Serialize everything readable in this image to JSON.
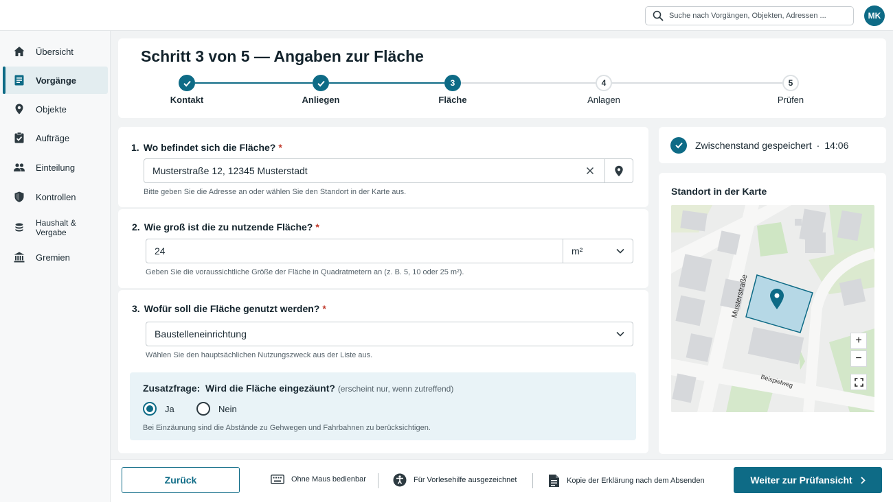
{
  "header": {
    "search_placeholder": "Suche nach Vorgängen, Objekten, Adressen ...",
    "avatar_initials": "MK"
  },
  "sidebar": {
    "items": [
      {
        "label": "Übersicht",
        "icon": "home-icon",
        "active": false
      },
      {
        "label": "Vorgänge",
        "icon": "document-list-icon",
        "active": true
      },
      {
        "label": "Objekte",
        "icon": "location-pin-icon",
        "active": false
      },
      {
        "label": "Aufträge",
        "icon": "clipboard-check-icon",
        "active": false
      },
      {
        "label": "Einteilung",
        "icon": "people-icon",
        "active": false
      },
      {
        "label": "Kontrollen",
        "icon": "shield-icon",
        "active": false
      },
      {
        "label": "Haushalt & Vergabe",
        "icon": "coins-icon",
        "active": false
      },
      {
        "label": "Gremien",
        "icon": "building-icon",
        "active": false
      }
    ]
  },
  "stepper": {
    "title": "Schritt 3 von 5 — Angaben zur Fläche",
    "steps": [
      {
        "label": "Kontakt",
        "number": "1",
        "state": "done"
      },
      {
        "label": "Anliegen",
        "number": "2",
        "state": "done"
      },
      {
        "label": "Fläche",
        "number": "3",
        "state": "current"
      },
      {
        "label": "Anlagen",
        "number": "4",
        "state": "todo"
      },
      {
        "label": "Prüfen",
        "number": "5",
        "state": "todo"
      }
    ]
  },
  "questions": {
    "q1": {
      "number": "1.",
      "label": "Wo befindet sich die Fläche?",
      "required_mark": "*",
      "value": "Musterstraße 12, 12345 Musterstadt",
      "hint": "Bitte geben Sie die Adresse an oder wählen Sie den Standort in der Karte aus."
    },
    "q2": {
      "number": "2.",
      "label": "Wie groß ist die zu nutzende Fläche?",
      "required_mark": "*",
      "value": "24",
      "unit": "m²",
      "hint": "Geben Sie die voraussichtliche Größe der Fläche in Quadratmetern an (z. B. 5, 10 oder 25 m²)."
    },
    "q3": {
      "number": "3.",
      "label": "Wofür soll die Fläche genutzt werden?",
      "required_mark": "*",
      "value": "Baustelleneinrichtung",
      "hint": "Wählen Sie den hauptsächlichen Nutzungszweck aus der Liste aus."
    },
    "extra": {
      "prefix": "Zusatzfrage:",
      "label": "Wird die Fläche eingezäunt?",
      "note": "(erscheint nur, wenn zutreffend)",
      "options": [
        "Ja",
        "Nein"
      ],
      "selected": "Ja",
      "hint": "Bei Einzäunung sind die Abstände zu Gehwegen und Fahrbahnen zu berücksichtigen."
    }
  },
  "status": {
    "saved_text": "Zwischenstand gespeichert",
    "separator": "·",
    "time": "14:06"
  },
  "map": {
    "title": "Standort in der Karte",
    "street_labels": [
      "Musterstraße",
      "Beispielweg"
    ],
    "zoom_in": "+",
    "zoom_out": "−"
  },
  "footer": {
    "back_label": "Zurück",
    "features": [
      {
        "label": "Ohne Maus bedienbar",
        "icon": "keyboard-icon"
      },
      {
        "label": "Für Vorlesehilfe ausgezeichnet",
        "icon": "accessibility-icon"
      },
      {
        "label": "Kopie der Erklärung nach dem Absenden",
        "icon": "document-icon"
      }
    ],
    "next_label": "Weiter zur Prüfansicht"
  },
  "colors": {
    "primary": "#0e6b86",
    "required": "#c0392b",
    "info_bg": "#e9f3f7"
  }
}
